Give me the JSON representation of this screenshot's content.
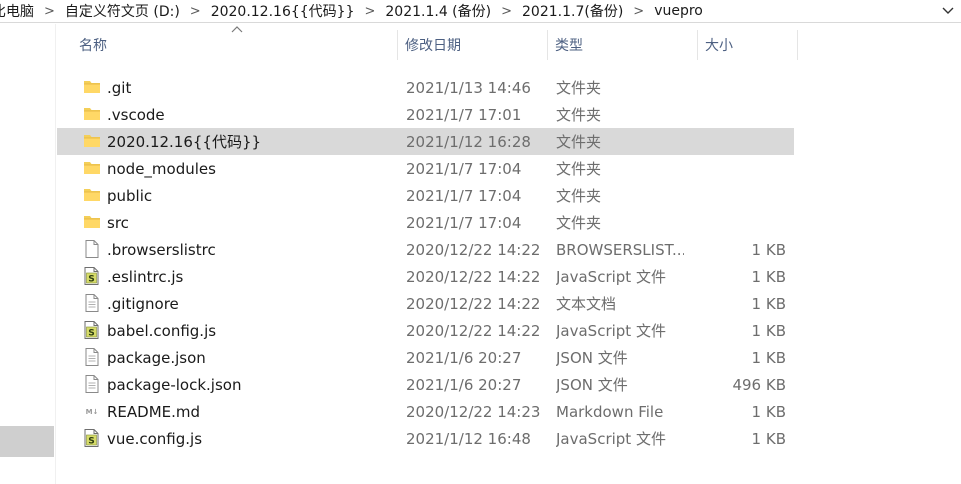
{
  "breadcrumb": {
    "items": [
      "比电脑",
      "自定义符文页 (D:)",
      "2020.12.16{{代码}}",
      "2021.1.4 (备份)",
      "2021.1.7(备份)",
      "vuepro"
    ]
  },
  "columns": {
    "name": "名称",
    "date": "修改日期",
    "type": "类型",
    "size": "大小"
  },
  "files": [
    {
      "name": ".git",
      "date": "2021/1/13 14:46",
      "type": "文件夹",
      "size": "",
      "icon": "folder-icon",
      "selected": false
    },
    {
      "name": ".vscode",
      "date": "2021/1/7 17:01",
      "type": "文件夹",
      "size": "",
      "icon": "folder-icon",
      "selected": false
    },
    {
      "name": "2020.12.16{{代码}}",
      "date": "2021/1/12 16:28",
      "type": "文件夹",
      "size": "",
      "icon": "folder-icon",
      "selected": true
    },
    {
      "name": "node_modules",
      "date": "2021/1/7 17:04",
      "type": "文件夹",
      "size": "",
      "icon": "folder-icon",
      "selected": false
    },
    {
      "name": "public",
      "date": "2021/1/7 17:04",
      "type": "文件夹",
      "size": "",
      "icon": "folder-icon",
      "selected": false
    },
    {
      "name": "src",
      "date": "2021/1/7 17:04",
      "type": "文件夹",
      "size": "",
      "icon": "folder-icon",
      "selected": false
    },
    {
      "name": ".browserslistrc",
      "date": "2020/12/22 14:22",
      "type": "BROWSERSLIST...",
      "size": "1 KB",
      "icon": "blank-file-icon",
      "selected": false
    },
    {
      "name": ".eslintrc.js",
      "date": "2020/12/22 14:22",
      "type": "JavaScript 文件",
      "size": "1 KB",
      "icon": "js-file-icon",
      "selected": false
    },
    {
      "name": ".gitignore",
      "date": "2020/12/22 14:22",
      "type": "文本文档",
      "size": "1 KB",
      "icon": "text-file-icon",
      "selected": false
    },
    {
      "name": "babel.config.js",
      "date": "2020/12/22 14:22",
      "type": "JavaScript 文件",
      "size": "1 KB",
      "icon": "js-file-icon",
      "selected": false
    },
    {
      "name": "package.json",
      "date": "2021/1/6 20:27",
      "type": "JSON 文件",
      "size": "1 KB",
      "icon": "text-file-icon",
      "selected": false
    },
    {
      "name": "package-lock.json",
      "date": "2021/1/6 20:27",
      "type": "JSON 文件",
      "size": "496 KB",
      "icon": "text-file-icon",
      "selected": false
    },
    {
      "name": "README.md",
      "date": "2020/12/22 14:23",
      "type": "Markdown File",
      "size": "1 KB",
      "icon": "markdown-file-icon",
      "selected": false
    },
    {
      "name": "vue.config.js",
      "date": "2021/1/12 16:48",
      "type": "JavaScript 文件",
      "size": "1 KB",
      "icon": "js-file-icon",
      "selected": false
    }
  ]
}
